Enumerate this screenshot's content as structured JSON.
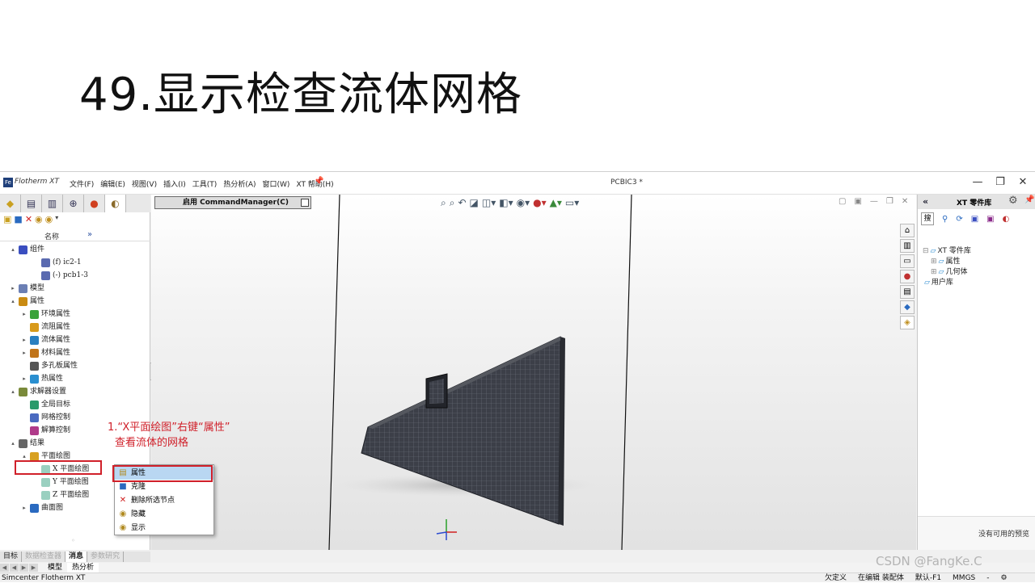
{
  "slide": {
    "title": "49.显示检查流体网格"
  },
  "titlebar": {
    "logo_text": "Fe",
    "app_name": "Flotherm XT",
    "menu": [
      "文件(F)",
      "编辑(E)",
      "视图(V)",
      "插入(I)",
      "工具(T)",
      "热分析(A)",
      "窗口(W)",
      "XT 帮助(H)"
    ],
    "document": "PCBIC3 *",
    "minimize": "—",
    "restore": "❐",
    "close": "✕"
  },
  "left_panel": {
    "header_name": "名称",
    "header_more": "»",
    "tree": [
      {
        "label": "组件",
        "indent": 0,
        "arrow": "▴",
        "icon": "component-icon",
        "color": "#3a4ec0"
      },
      {
        "label": "(f) ic2-1",
        "indent": 2,
        "arrow": "",
        "icon": "part-icon",
        "color": "#5a6ab0"
      },
      {
        "label": "(-) pcb1-3",
        "indent": 2,
        "arrow": "",
        "icon": "part-icon",
        "color": "#5a6ab0"
      },
      {
        "label": "模型",
        "indent": 0,
        "arrow": "▸",
        "icon": "model-icon",
        "color": "#6b7fb4"
      },
      {
        "label": "属性",
        "indent": 0,
        "arrow": "▴",
        "icon": "property-icon",
        "color": "#c98b12"
      },
      {
        "label": "环境属性",
        "indent": 1,
        "arrow": "▸",
        "icon": "ambient-icon",
        "color": "#3aa23a"
      },
      {
        "label": "流阻属性",
        "indent": 1,
        "arrow": "",
        "icon": "resistance-icon",
        "color": "#d89a1a"
      },
      {
        "label": "流体属性",
        "indent": 1,
        "arrow": "▸",
        "icon": "fluid-icon",
        "color": "#2a7fc0"
      },
      {
        "label": "材料属性",
        "indent": 1,
        "arrow": "▸",
        "icon": "material-icon",
        "color": "#c0741a"
      },
      {
        "label": "多孔板属性",
        "indent": 1,
        "arrow": "",
        "icon": "perforated-icon",
        "color": "#555555"
      },
      {
        "label": "热属性",
        "indent": 1,
        "arrow": "▸",
        "icon": "thermal-icon",
        "color": "#2a8fd0"
      },
      {
        "label": "求解器设置",
        "indent": 0,
        "arrow": "▴",
        "icon": "solver-icon",
        "color": "#7a8a3a"
      },
      {
        "label": "全局目标",
        "indent": 1,
        "arrow": "",
        "icon": "goal-icon",
        "color": "#2a9a6a"
      },
      {
        "label": "网格控制",
        "indent": 1,
        "arrow": "",
        "icon": "mesh-icon",
        "color": "#4a6ac0"
      },
      {
        "label": "解算控制",
        "indent": 1,
        "arrow": "",
        "icon": "solve-icon",
        "color": "#b03a8a"
      },
      {
        "label": "结果",
        "indent": 0,
        "arrow": "▴",
        "icon": "results-icon",
        "color": "#666666"
      },
      {
        "label": "平面绘图",
        "indent": 1,
        "arrow": "▴",
        "icon": "plot-icon",
        "color": "#d8a020"
      },
      {
        "label": "X 平面绘图",
        "indent": 2,
        "arrow": "",
        "icon": "x-plane-icon",
        "color": "#9ad0c0"
      },
      {
        "label": "Y 平面绘图",
        "indent": 2,
        "arrow": "",
        "icon": "y-plane-icon",
        "color": "#9ad0c0"
      },
      {
        "label": "Z 平面绘图",
        "indent": 2,
        "arrow": "",
        "icon": "z-plane-icon",
        "color": "#9ad0c0"
      },
      {
        "label": "曲面图",
        "indent": 1,
        "arrow": "▸",
        "icon": "surface-icon",
        "color": "#2a6ac0"
      }
    ],
    "bottom_tabs": [
      {
        "label": "目标",
        "state": "normal"
      },
      {
        "label": "数据检查器",
        "state": "dim"
      },
      {
        "label": "消息",
        "state": "active"
      },
      {
        "label": "参数研究",
        "state": "dim"
      }
    ]
  },
  "annotation": {
    "line1": "1.“X平面绘图”右键“属性”",
    "line2": "查看流体的网格",
    "color": "#d0202a"
  },
  "context_menu": {
    "items": [
      {
        "label": "属性",
        "icon": "properties-icon",
        "glyph": "▤",
        "selected": true
      },
      {
        "label": "克隆",
        "icon": "clone-icon",
        "glyph": "■",
        "selected": false
      },
      {
        "label": "删除所选节点",
        "icon": "delete-icon",
        "glyph": "✕",
        "selected": false
      },
      {
        "label": "隐藏",
        "icon": "hide-icon",
        "glyph": "◉",
        "selected": false
      },
      {
        "label": "显示",
        "icon": "show-icon",
        "glyph": "◉",
        "selected": false
      }
    ]
  },
  "viewport": {
    "command_manager": "启用 CommandManager(C)"
  },
  "sheet_tabs": [
    "模型",
    "热分析"
  ],
  "statusbar": {
    "left": "Simcenter Flotherm XT",
    "right": [
      "欠定义",
      "在编辑 装配体",
      "默认-F1",
      "MMGS",
      "-"
    ]
  },
  "right_panel": {
    "collapse": "«",
    "title": "XT 零件库",
    "search_label": "搜",
    "tree": [
      {
        "label": "XT 零件库",
        "indent": 0,
        "prefix": "⊟"
      },
      {
        "label": "属性",
        "indent": 1,
        "prefix": "⊞"
      },
      {
        "label": "几何体",
        "indent": 1,
        "prefix": "⊞"
      },
      {
        "label": "用户库",
        "indent": 0,
        "prefix": ""
      }
    ],
    "preview_text": "没有可用的预览"
  },
  "watermark": "CSDN @FangKe.C"
}
